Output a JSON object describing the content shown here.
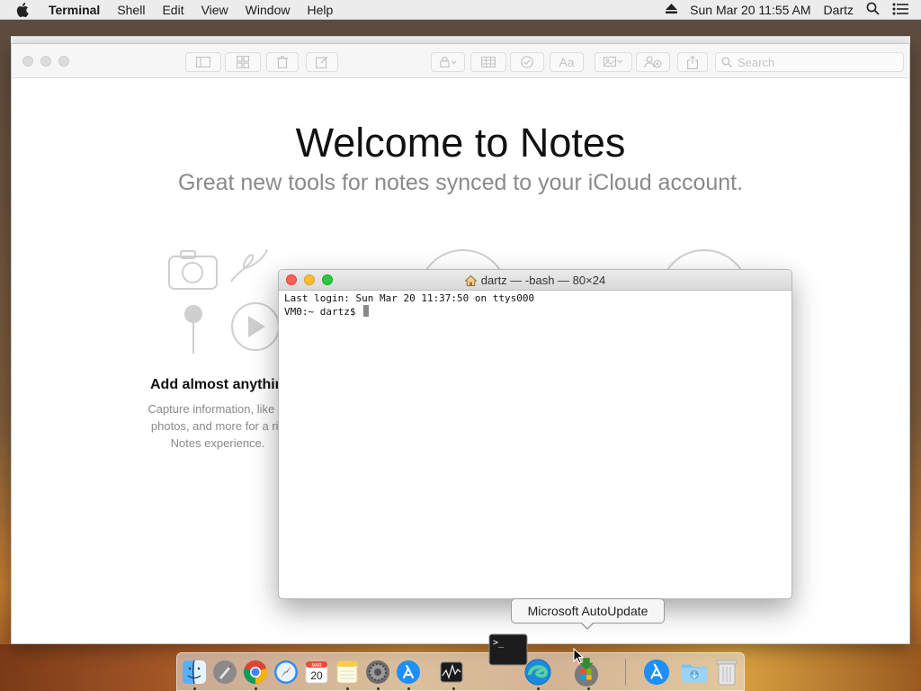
{
  "menubar": {
    "apple_icon": "apple-logo-icon",
    "app_name": "Terminal",
    "menus": [
      "Shell",
      "Edit",
      "View",
      "Window",
      "Help"
    ],
    "datetime": "Sun Mar 20  11:55 AM",
    "user": "Dartz",
    "eject_icon": "eject-icon",
    "spotlight_icon": "search-icon",
    "notification_icon": "list-icon"
  },
  "notes": {
    "search_placeholder": "Search",
    "welcome_title": "Welcome to Notes",
    "welcome_subtitle": "Great new tools for notes synced to your iCloud account.",
    "feature_title": "Add almost anythin",
    "feature_desc_lines": [
      "Capture information, like m",
      "photos, and more for a ric",
      "Notes experience."
    ]
  },
  "terminal": {
    "title": "dartz — -bash — 80×24",
    "lines": [
      "Last login: Sun Mar 20 11:37:50 on ttys000",
      "VM0:~ dartz$ "
    ]
  },
  "tooltip": {
    "text": "Microsoft AutoUpdate"
  },
  "dock": {
    "items": [
      {
        "name": "finder-icon",
        "running": true
      },
      {
        "name": "launchpad-icon",
        "running": false
      },
      {
        "name": "chrome-icon",
        "running": true
      },
      {
        "name": "safari-icon",
        "running": false
      },
      {
        "name": "calendar-icon",
        "running": false,
        "label": "20",
        "month": "MAR"
      },
      {
        "name": "notes-icon",
        "running": true
      },
      {
        "name": "system-preferences-icon",
        "running": true
      },
      {
        "name": "app-store-icon",
        "running": true
      },
      {
        "name": "activity-monitor-icon",
        "running": true
      },
      {
        "name": "terminal-icon",
        "running": true
      },
      {
        "name": "edge-icon",
        "running": true
      },
      {
        "name": "microsoft-autoupdate-icon",
        "running": true
      },
      {
        "name": "app-store-folder-icon",
        "running": false
      },
      {
        "name": "downloads-folder-icon",
        "running": false
      },
      {
        "name": "trash-icon",
        "running": false
      }
    ]
  },
  "colors": {
    "close": "#fe5f57",
    "minimize": "#febc2e",
    "zoom": "#28c840"
  }
}
